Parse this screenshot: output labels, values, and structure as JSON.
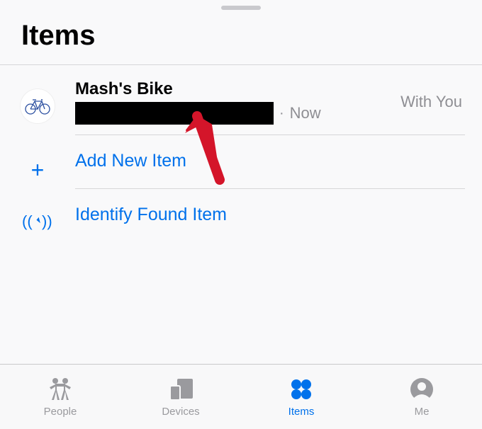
{
  "header": {
    "title": "Items"
  },
  "item": {
    "name": "Mash's Bike",
    "status_separator": "·",
    "status_time": "Now",
    "status_with_you": "With You",
    "icon": "bicycle-icon"
  },
  "actions": {
    "add_new": "Add New Item",
    "identify": "Identify Found Item"
  },
  "tabs": {
    "people": "People",
    "devices": "Devices",
    "items": "Items",
    "me": "Me"
  },
  "colors": {
    "accent": "#0071eb",
    "inactive": "#9a9a9e",
    "secondary_text": "#8e8e93"
  }
}
